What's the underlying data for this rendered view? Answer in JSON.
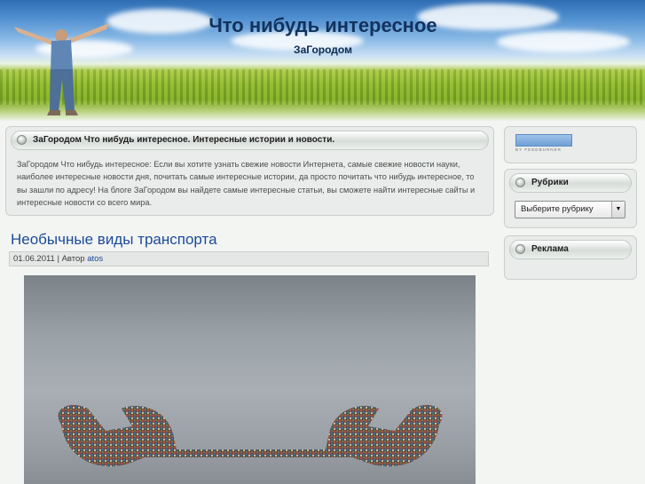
{
  "header": {
    "title": "Что нибудь интересное",
    "subtitle": "ЗаГородом"
  },
  "intro": {
    "heading": "ЗаГородом Что нибудь интересное. Интересные истории и новости.",
    "text": "ЗаГородом Что нибудь интересное: Если вы хотите узнать свежие новости Интернета, самые свежие новости науки, наиболее интересные новости дня, почитать самые интересные истории, да просто почитать что нибудь интересное, то вы зашли по адресу! На блоге ЗаГородом вы найдете самые интересные статьи, вы сможете найти интересные сайты и интересные новости со всего мира."
  },
  "post": {
    "title": "Необычные виды транспорта",
    "date": "01.06.2011",
    "author_prefix": "| Автор",
    "author": "atos"
  },
  "sidebar": {
    "feed_label": "BY FEEDBURNER",
    "categories_heading": "Рубрики",
    "categories_select": "Выберите рубрику",
    "ads_heading": "Реклама"
  },
  "colors": {
    "title": "#12325d",
    "link": "#1c4a99"
  }
}
